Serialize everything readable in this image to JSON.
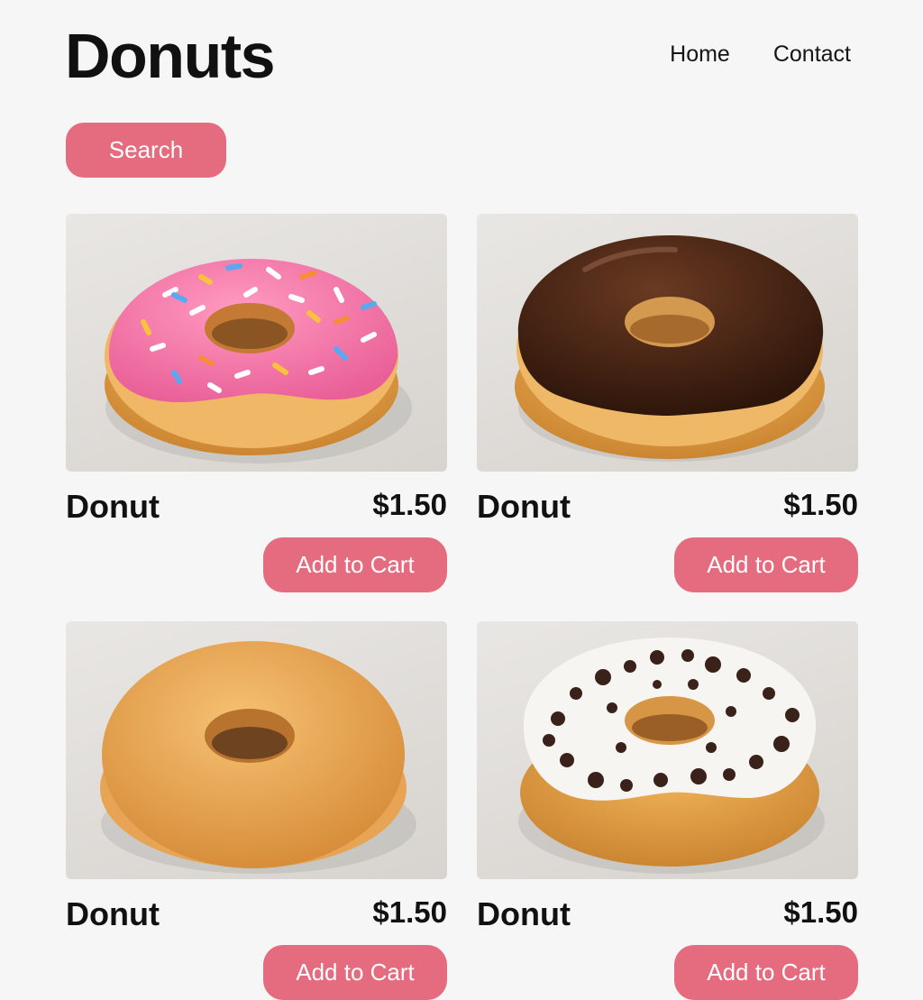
{
  "header": {
    "title": "Donuts",
    "nav": [
      "Home",
      "Contact"
    ]
  },
  "search": {
    "label": "Search"
  },
  "products": [
    {
      "name": "Donut",
      "price": "$1.50",
      "cart_label": "Add to Cart",
      "image": "pink-sprinkle-donut"
    },
    {
      "name": "Donut",
      "price": "$1.50",
      "cart_label": "Add to Cart",
      "image": "chocolate-glazed-donut"
    },
    {
      "name": "Donut",
      "price": "$1.50",
      "cart_label": "Add to Cart",
      "image": "sugar-donut"
    },
    {
      "name": "Donut",
      "price": "$1.50",
      "cart_label": "Add to Cart",
      "image": "cookies-and-cream-donut"
    }
  ],
  "colors": {
    "accent": "#e56b7e",
    "background": "#f6f6f6",
    "text": "#111111"
  }
}
